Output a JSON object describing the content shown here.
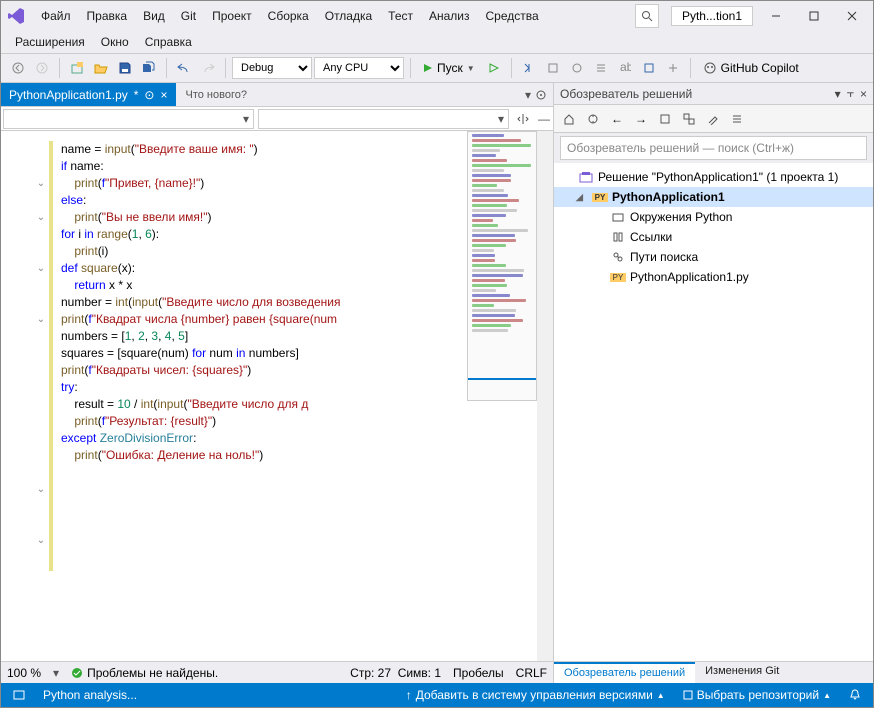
{
  "menu": [
    "Файл",
    "Правка",
    "Вид",
    "Git",
    "Проект",
    "Сборка",
    "Отладка",
    "Тест",
    "Анализ",
    "Средства"
  ],
  "menu2": [
    "Расширения",
    "Окно",
    "Справка"
  ],
  "pathTab": "Pyth...tion1",
  "toolbar": {
    "config": "Debug",
    "platform": "Any CPU",
    "run": "Пуск",
    "copilot": "GitHub Copilot"
  },
  "tabs": {
    "file": "PythonApplication1.py",
    "modified": "*",
    "whatsnew": "Что нового?"
  },
  "code": [
    {
      "i": 0,
      "t": "name = input(\"Введите ваше имя: \")",
      "tok": [
        [
          "",
          "name = "
        ],
        [
          "fn",
          "input"
        ],
        [
          "",
          "("
        ],
        [
          "str",
          "\"Введите ваше имя: \""
        ],
        [
          "",
          ")"
        ]
      ]
    },
    {
      "i": 0,
      "t": ""
    },
    {
      "fold": true,
      "i": 0,
      "tok": [
        [
          "kw",
          "if"
        ],
        [
          "",
          " name:"
        ]
      ]
    },
    {
      "i": 1,
      "tok": [
        [
          "fn",
          "print"
        ],
        [
          "",
          "("
        ],
        [
          "kw",
          "f"
        ],
        [
          "str",
          "\"Привет, {name}!\""
        ],
        [
          "",
          ")"
        ]
      ]
    },
    {
      "fold": true,
      "i": 0,
      "tok": [
        [
          "kw",
          "else"
        ],
        [
          "",
          ":"
        ]
      ]
    },
    {
      "i": 1,
      "tok": [
        [
          "fn",
          "print"
        ],
        [
          "",
          "("
        ],
        [
          "str",
          "\"Вы не ввели имя!\""
        ],
        [
          "",
          ")"
        ]
      ]
    },
    {
      "i": 0,
      "t": ""
    },
    {
      "fold": true,
      "i": 0,
      "tok": [
        [
          "kw",
          "for"
        ],
        [
          "",
          " i "
        ],
        [
          "kw",
          "in"
        ],
        [
          "",
          " "
        ],
        [
          "fn",
          "range"
        ],
        [
          "",
          "("
        ],
        [
          "num",
          "1"
        ],
        [
          "",
          ", "
        ],
        [
          "num",
          "6"
        ],
        [
          "",
          "):"
        ]
      ]
    },
    {
      "i": 1,
      "tok": [
        [
          "fn",
          "print"
        ],
        [
          "",
          "(i)"
        ]
      ]
    },
    {
      "i": 0,
      "t": ""
    },
    {
      "fold": true,
      "i": 0,
      "tok": [
        [
          "kw",
          "def"
        ],
        [
          "",
          " "
        ],
        [
          "fn",
          "square"
        ],
        [
          "",
          "(x):"
        ]
      ]
    },
    {
      "i": 1,
      "tok": [
        [
          "kw",
          "return"
        ],
        [
          "",
          " x * x"
        ]
      ]
    },
    {
      "i": 0,
      "t": ""
    },
    {
      "i": 0,
      "tok": [
        [
          "",
          "number = "
        ],
        [
          "fn",
          "int"
        ],
        [
          "",
          "("
        ],
        [
          "fn",
          "input"
        ],
        [
          "",
          "("
        ],
        [
          "str",
          "\"Введите число для возведения"
        ]
      ]
    },
    {
      "i": 0,
      "tok": [
        [
          "fn",
          "print"
        ],
        [
          "",
          "("
        ],
        [
          "kw",
          "f"
        ],
        [
          "str",
          "\"Квадрат числа {number} равен {square(num"
        ]
      ]
    },
    {
      "i": 0,
      "t": ""
    },
    {
      "i": 0,
      "tok": [
        [
          "",
          "numbers = ["
        ],
        [
          "num",
          "1"
        ],
        [
          "",
          ", "
        ],
        [
          "num",
          "2"
        ],
        [
          "",
          ", "
        ],
        [
          "num",
          "3"
        ],
        [
          "",
          ", "
        ],
        [
          "num",
          "4"
        ],
        [
          "",
          ", "
        ],
        [
          "num",
          "5"
        ],
        [
          "",
          "]"
        ]
      ]
    },
    {
      "i": 0,
      "tok": [
        [
          "",
          "squares = [square(num) "
        ],
        [
          "kw",
          "for"
        ],
        [
          "",
          " num "
        ],
        [
          "kw",
          "in"
        ],
        [
          "",
          " numbers]"
        ]
      ]
    },
    {
      "i": 0,
      "tok": [
        [
          "fn",
          "print"
        ],
        [
          "",
          "("
        ],
        [
          "kw",
          "f"
        ],
        [
          "str",
          "\"Квадраты чисел: {squares}\""
        ],
        [
          "",
          ")"
        ]
      ]
    },
    {
      "i": 0,
      "t": ""
    },
    {
      "fold": true,
      "i": 0,
      "tok": [
        [
          "kw",
          "try"
        ],
        [
          "",
          ":"
        ]
      ]
    },
    {
      "i": 1,
      "tok": [
        [
          "",
          "result = "
        ],
        [
          "num",
          "10"
        ],
        [
          "",
          " / "
        ],
        [
          "fn",
          "int"
        ],
        [
          "",
          "("
        ],
        [
          "fn",
          "input"
        ],
        [
          "",
          "("
        ],
        [
          "str",
          "\"Введите число для д"
        ]
      ]
    },
    {
      "i": 1,
      "tok": [
        [
          "fn",
          "print"
        ],
        [
          "",
          "("
        ],
        [
          "kw",
          "f"
        ],
        [
          "str",
          "\"Результат: {result}\""
        ],
        [
          "",
          ")"
        ]
      ]
    },
    {
      "fold": true,
      "i": 0,
      "tok": [
        [
          "kw",
          "except"
        ],
        [
          "",
          " "
        ],
        [
          "cls",
          "ZeroDivisionError"
        ],
        [
          "",
          ":"
        ]
      ]
    },
    {
      "i": 1,
      "tok": [
        [
          "fn",
          "print"
        ],
        [
          "",
          "("
        ],
        [
          "str",
          "\"Ошибка: Деление на ноль!\""
        ],
        [
          "",
          ")"
        ]
      ]
    }
  ],
  "editorStatus": {
    "zoom": "100 %",
    "problems": "Проблемы не найдены.",
    "line": "Стр: 27",
    "col": "Симв: 1",
    "indent": "Пробелы",
    "eol": "CRLF"
  },
  "solution": {
    "title": "Обозреватель решений",
    "searchPlaceholder": "Обозреватель решений — поиск (Ctrl+ж)",
    "root": "Решение \"PythonApplication1\"  (1 проекта 1)",
    "project": "PythonApplication1",
    "nodes": [
      "Окружения Python",
      "Ссылки",
      "Пути поиска",
      "PythonApplication1.py"
    ],
    "tabs": [
      "Обозреватель решений",
      "Изменения Git"
    ]
  },
  "statusBar": {
    "task": "Python analysis...",
    "addSc": "Добавить в систему управления версиями",
    "repo": "Выбрать репозиторий"
  }
}
